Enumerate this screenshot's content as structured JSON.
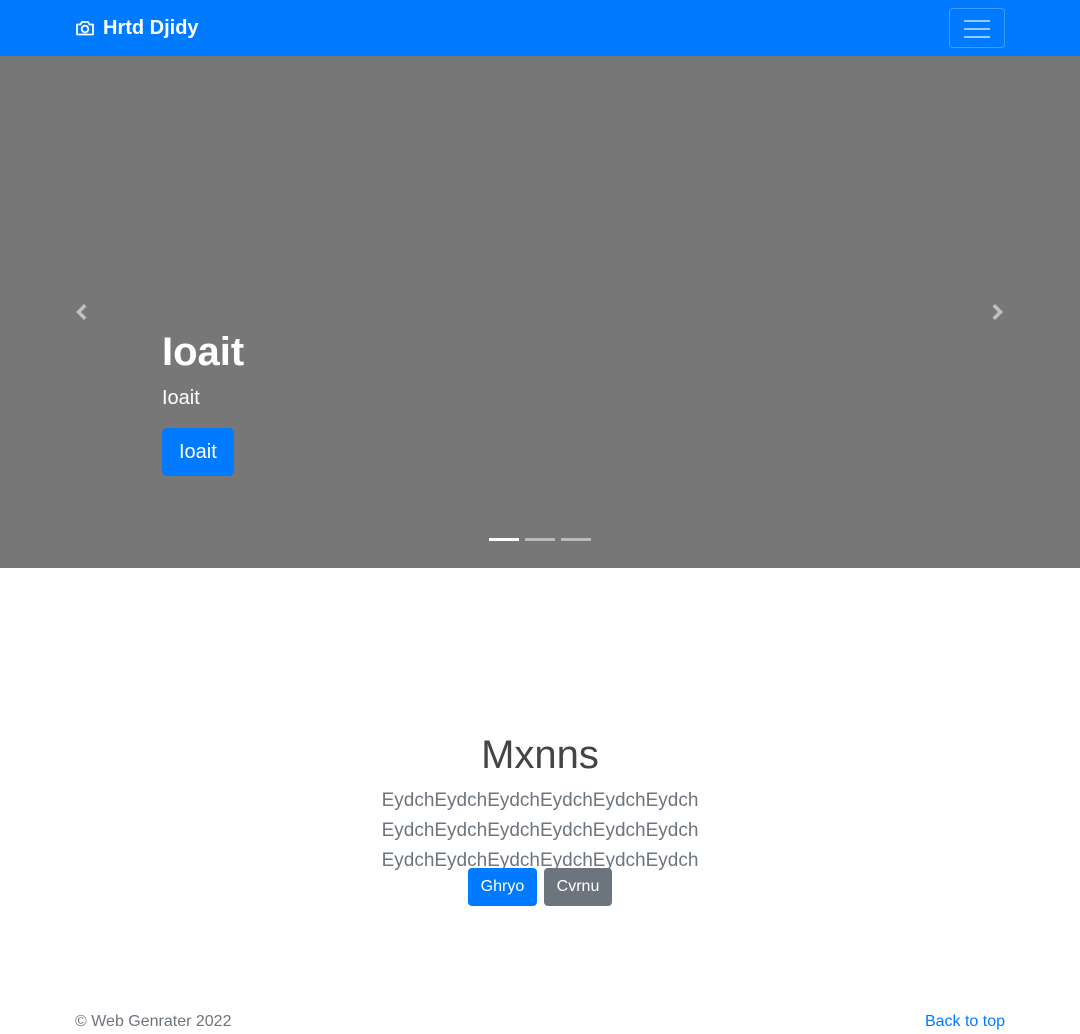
{
  "navbar": {
    "brand_text": "Hrtd Djidy",
    "brand_icon": "camera-icon",
    "toggler_icon": "hamburger-icon",
    "background_color": "#007bff"
  },
  "carousel": {
    "background_color": "#777777",
    "slide": {
      "heading": "Ioait",
      "text": "Ioait",
      "button_label": "Ioait"
    },
    "prev_icon": "chevron-left-icon",
    "next_icon": "chevron-right-icon",
    "indicator_count": 3,
    "active_indicator": 1
  },
  "section": {
    "title": "Mxnns",
    "lead": "EydchEydchEydchEydchEydchEydch EydchEydchEydchEydchEydchEydch EydchEydchEydchEydchEydchEydch",
    "primary_button": "Ghryo",
    "secondary_button": "Cvrnu"
  },
  "footer": {
    "copyright": "© Web Genrater 2022",
    "back_to_top": "Back to top"
  },
  "colors": {
    "primary": "#007bff",
    "secondary": "#6c757d",
    "muted_text": "#6c757d"
  }
}
